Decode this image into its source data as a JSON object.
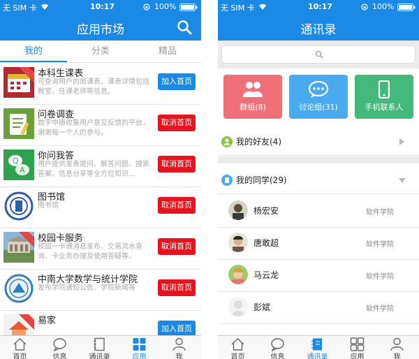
{
  "colors": {
    "accent": "#1a8ae6",
    "cancel": "#e6141f",
    "group": "#f0707a",
    "discuss": "#4aaaf0",
    "contact": "#42b97a"
  },
  "left": {
    "status": {
      "carrier": "无 SIM 卡",
      "time": "10:17",
      "battery": "100%"
    },
    "title": "应用市场",
    "tabs": [
      {
        "label": "我的",
        "active": true
      },
      {
        "label": "分类"
      },
      {
        "label": "精品"
      }
    ],
    "apps": [
      {
        "name": "本科生课表",
        "desc": "可查询用户的周课表、课表详情包括教室、任课老师等信息。",
        "button": "加入首页",
        "kind": "add",
        "icon": "calendar-app-icon"
      },
      {
        "name": "问卷调查",
        "desc": "数字中南收集用户意见反馈的平台，谢谢每一个人的参与。",
        "button": "取消首页",
        "kind": "cancel",
        "icon": "survey-app-icon"
      },
      {
        "name": "你问我答",
        "desc": "用户提供发表提问、解答问题、搜索答案、信息分享等全方位知识...",
        "button": "取消首页",
        "kind": "cancel",
        "icon": "qa-app-icon"
      },
      {
        "name": "图书馆",
        "desc": "图书馆",
        "button": "取消首页",
        "kind": "cancel",
        "icon": "library-app-icon"
      },
      {
        "name": "校园卡服务",
        "desc": "校园一卡通消息发布、交易流水查询、卡业务办理及使用答疑等。",
        "button": "取消首页",
        "kind": "cancel",
        "icon": "campus-card-app-icon"
      },
      {
        "name": "中南大学数学与统计学院",
        "desc": "发布学院通知公告、学院新闻等",
        "button": "取消首页",
        "kind": "cancel",
        "icon": "school-emblem-app-icon"
      },
      {
        "name": "易家",
        "desc": "",
        "button": "加入首页",
        "kind": "add",
        "icon": "home-app-icon"
      }
    ],
    "tabbar": [
      {
        "label": "首页",
        "icon": "home-icon"
      },
      {
        "label": "信息",
        "icon": "message-icon"
      },
      {
        "label": "通讯录",
        "icon": "contacts-icon"
      },
      {
        "label": "应用",
        "icon": "apps-grid-icon",
        "active": true
      },
      {
        "label": "我",
        "icon": "user-icon"
      }
    ]
  },
  "right": {
    "status": {
      "carrier": "无 SIM 卡",
      "time": "10:17",
      "battery": "100%"
    },
    "title": "通讯录",
    "search": {
      "placeholder": ""
    },
    "tiles": [
      {
        "label": "群组(8)",
        "icon": "group-icon"
      },
      {
        "label": "讨论组(31)",
        "icon": "chat-bubble-icon"
      },
      {
        "label": "手机联系人",
        "icon": "phone-icon"
      }
    ],
    "sections": [
      {
        "label": "我的好友(4)",
        "expanded": false
      },
      {
        "label": "我的同学(29)",
        "expanded": true
      }
    ],
    "contacts": [
      {
        "name": "杨宏安",
        "dept": "软件学院"
      },
      {
        "name": "唐敢超",
        "dept": "软件学院"
      },
      {
        "name": "马云龙",
        "dept": "软件学院"
      },
      {
        "name": "彭斌",
        "dept": "软件学院"
      }
    ],
    "tabbar": [
      {
        "label": "首页",
        "icon": "home-icon"
      },
      {
        "label": "信息",
        "icon": "message-icon"
      },
      {
        "label": "通讯录",
        "icon": "contacts-icon",
        "active": true
      },
      {
        "label": "应用",
        "icon": "apps-grid-icon"
      },
      {
        "label": "我",
        "icon": "user-icon"
      }
    ]
  }
}
